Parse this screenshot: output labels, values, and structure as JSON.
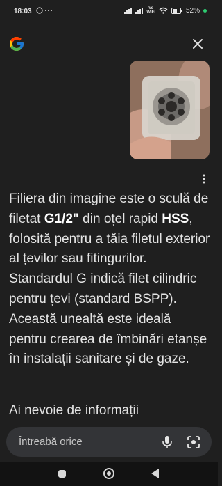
{
  "status_bar": {
    "time": "18:03",
    "left_icons": "© ···",
    "network_label": "Vo WiFi",
    "battery": "52%",
    "battery_dot_color": "#2ecc71"
  },
  "header": {
    "logo_icon": "google-g-icon",
    "close_icon": "close-icon"
  },
  "image_card": {
    "description_icon": "die-in-box-photo"
  },
  "answer": {
    "p1": "Filiera din imagine este o sculă de filetat ",
    "b1": "G1/2\"",
    "p2": " din oțel rapid ",
    "b2": "HSS",
    "p3": ", folosită pentru a tăia filetul exterior al țevilor sau fitingurilor. Standardul G indică filet cilindric pentru țevi (standard BSPP). Această unealtă este ideală pentru crearea de îmbinări etanșe în instalații sanitare și de gaze."
  },
  "followup": {
    "text": "Ai nevoie de informații"
  },
  "input": {
    "placeholder": "Întreabă orice",
    "value": ""
  },
  "nav": {
    "recents_icon": "square-icon",
    "home_icon": "circle-icon",
    "back_icon": "triangle-back-icon"
  }
}
